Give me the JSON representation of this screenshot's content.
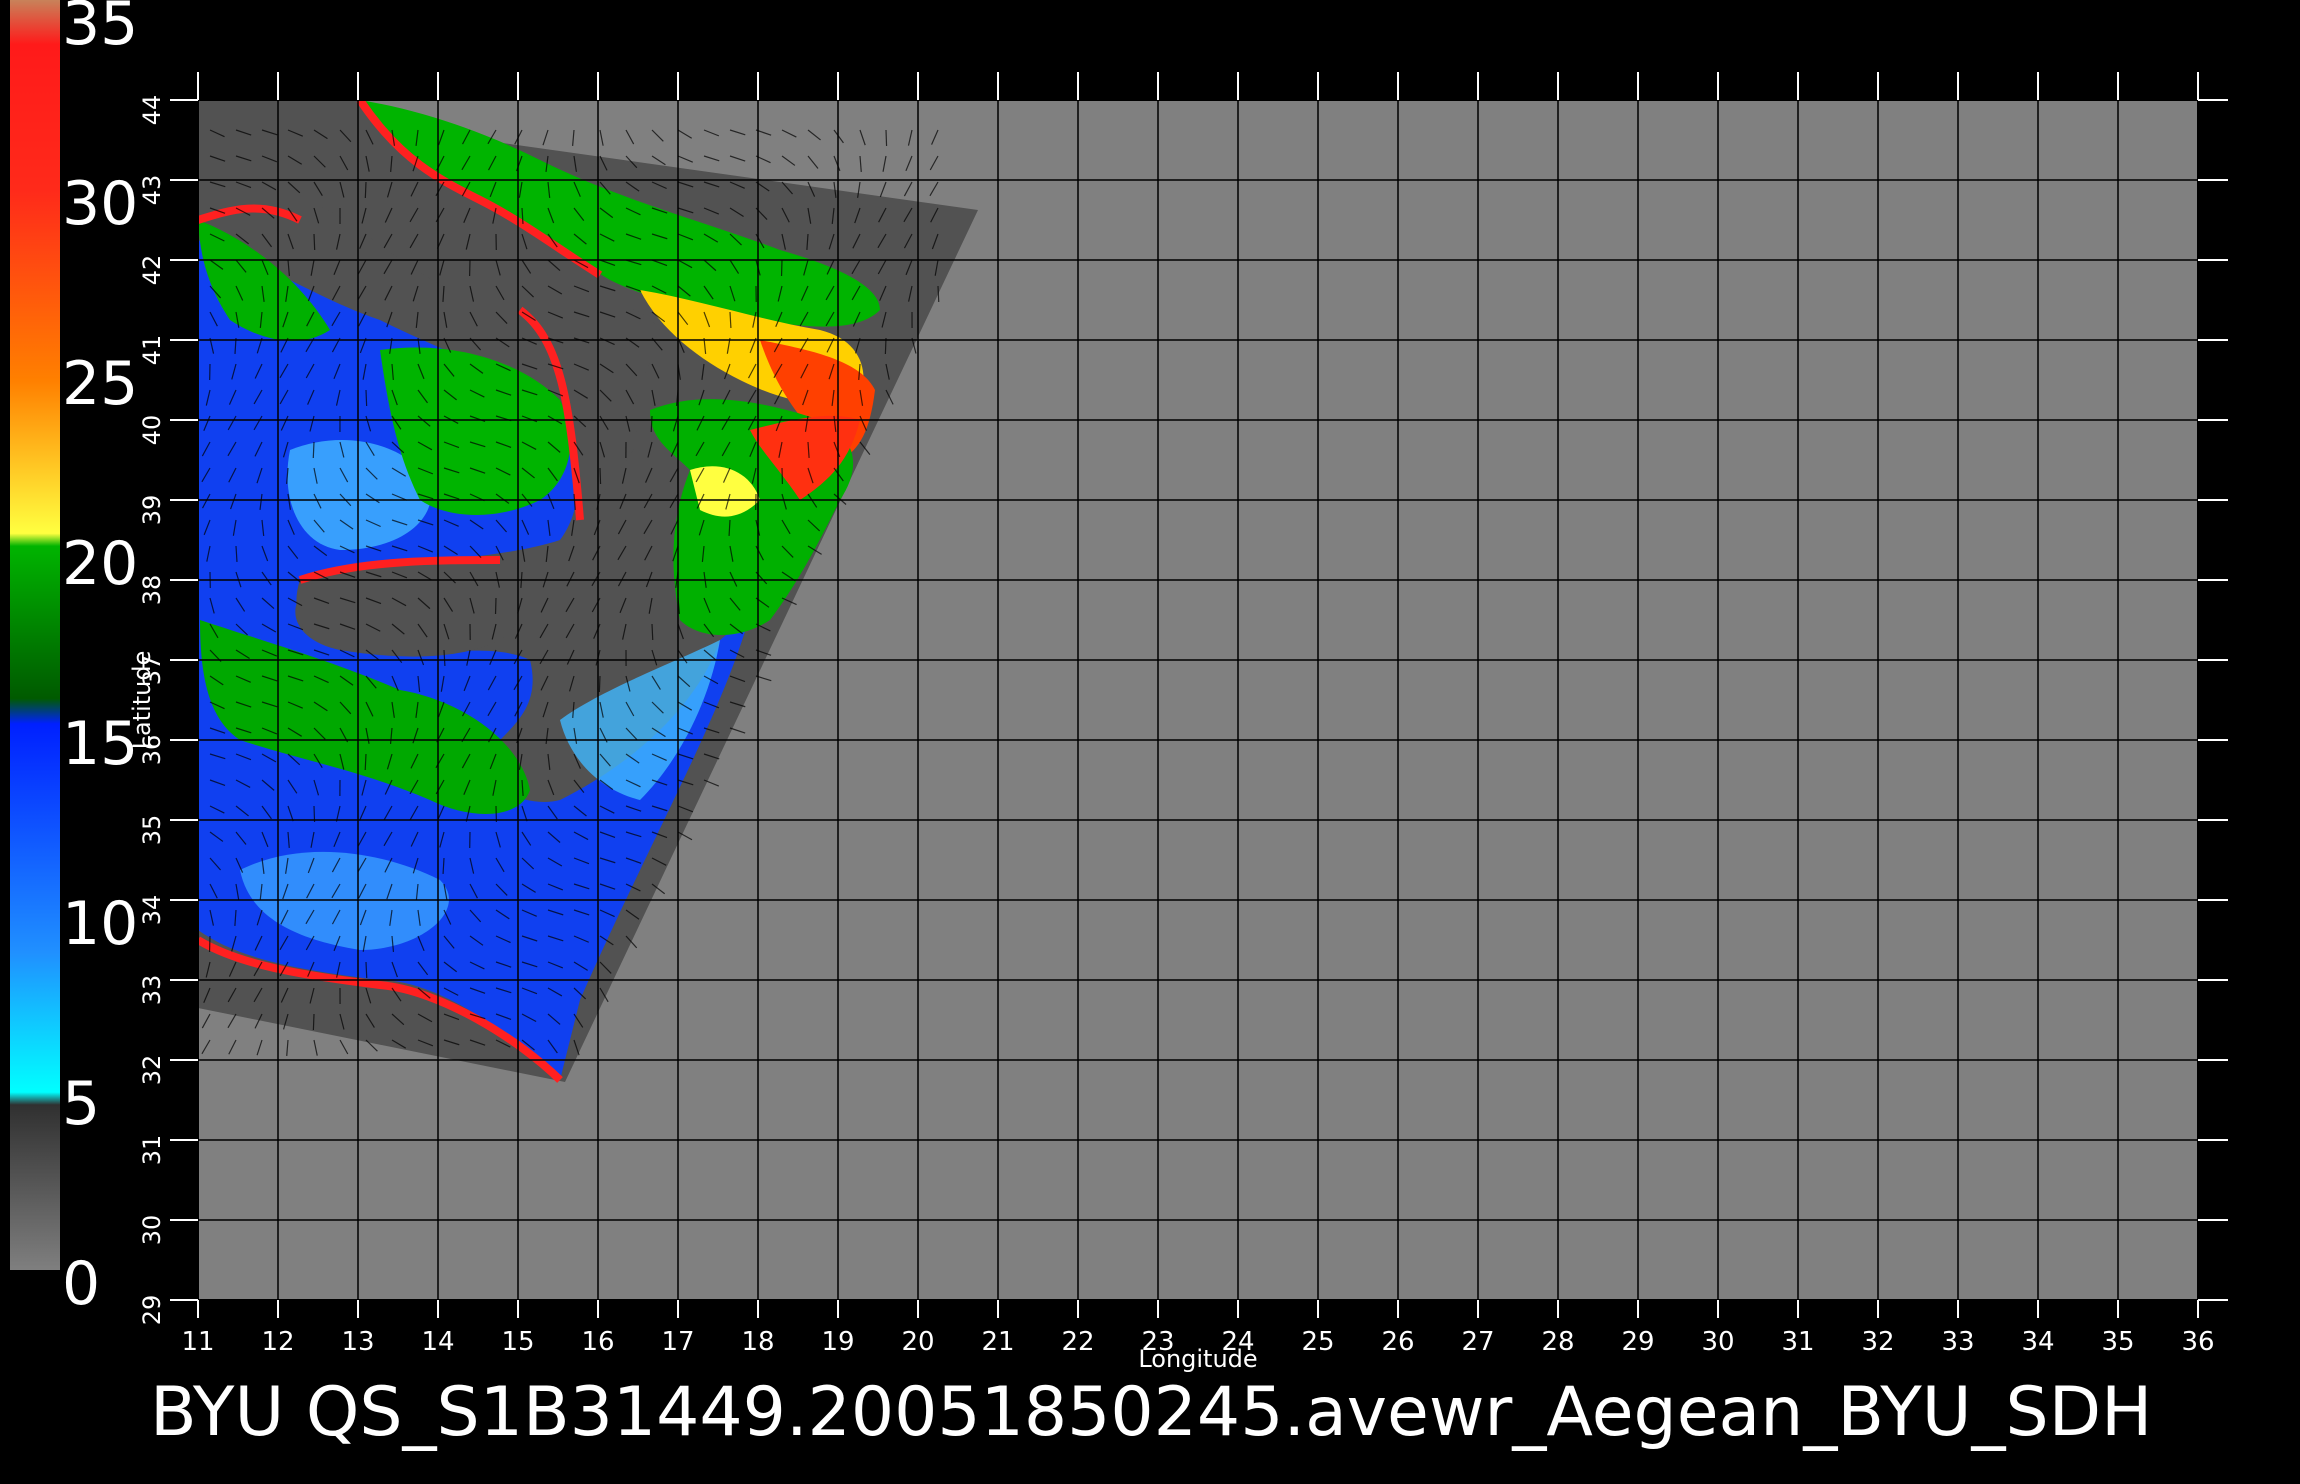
{
  "colorbar": {
    "ticks": [
      "35",
      "30",
      "25",
      "20",
      "15",
      "10",
      "5",
      "0"
    ],
    "colors": [
      "#c8825a",
      "#ff1a1a",
      "#ff8000",
      "#ffff00",
      "#00b400",
      "#0050ff",
      "#00ffff",
      "#404040",
      "#7f7f7f"
    ]
  },
  "map": {
    "xlabel": "Longitude",
    "ylabel": "Latitude",
    "lon_ticks": [
      "11",
      "12",
      "13",
      "14",
      "15",
      "16",
      "17",
      "18",
      "19",
      "20",
      "21",
      "22",
      "23",
      "24",
      "25",
      "26",
      "27",
      "28",
      "29",
      "30",
      "31",
      "32",
      "33",
      "34",
      "35",
      "36"
    ],
    "lat_ticks": [
      "29",
      "30",
      "31",
      "32",
      "33",
      "34",
      "35",
      "36",
      "37",
      "38",
      "39",
      "40",
      "41",
      "42",
      "43",
      "44"
    ],
    "lon_range": [
      11,
      36
    ],
    "lat_range": [
      29,
      44
    ],
    "background_color": "#808080",
    "swath_color": "#525252"
  },
  "caption": "BYU QS_S1B31449.20051850245.avewr_Aegean_BYU_SDH"
}
